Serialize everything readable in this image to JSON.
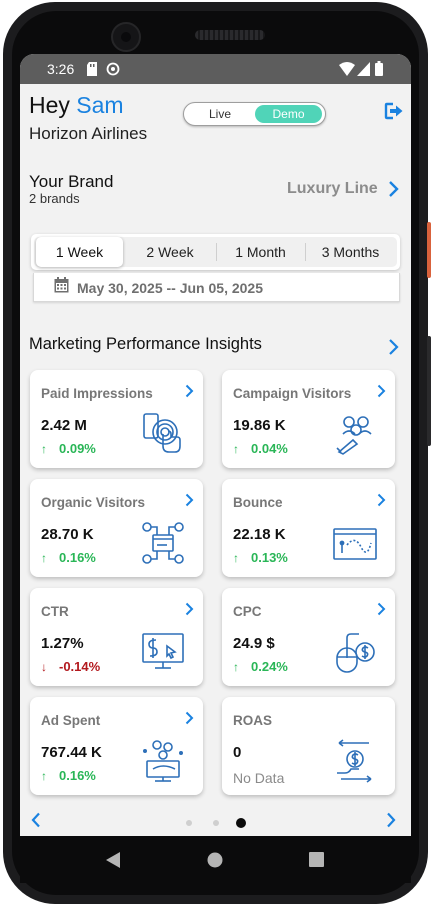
{
  "status_bar": {
    "time": "3:26"
  },
  "header": {
    "greeting": "Hey",
    "user_name": "Sam",
    "company": "Horizon Airlines"
  },
  "mode_toggle": {
    "live_label": "Live",
    "demo_label": "Demo",
    "selected": "Demo"
  },
  "brand": {
    "title": "Your Brand",
    "count_label": "2 brands",
    "selected_brand": "Luxury Line"
  },
  "date_range": {
    "options": [
      "1 Week",
      "2 Week",
      "1 Month",
      "3 Months"
    ],
    "selected": "1 Week",
    "range_text": "May 30, 2025  -- Jun 05, 2025"
  },
  "insights": {
    "title": "Marketing Performance Insights",
    "cards": [
      {
        "title": "Paid Impressions",
        "value": "2.42 M",
        "change": "0.09%",
        "direction": "up",
        "icon": "touch-screen-icon"
      },
      {
        "title": "Campaign Visitors",
        "value": "19.86 K",
        "change": "0.04%",
        "direction": "up",
        "icon": "megaphone-audience-icon"
      },
      {
        "title": "Organic Visitors",
        "value": "28.70 K",
        "change": "0.16%",
        "direction": "up",
        "icon": "network-users-icon"
      },
      {
        "title": "Bounce",
        "value": "22.18 K",
        "change": "0.13%",
        "direction": "up",
        "icon": "bounce-browser-icon"
      },
      {
        "title": "CTR",
        "value": "1.27%",
        "change": "-0.14%",
        "direction": "down",
        "icon": "monitor-click-icon"
      },
      {
        "title": "CPC",
        "value": "24.9 $",
        "change": "0.24%",
        "direction": "up",
        "icon": "mouse-dollar-icon"
      },
      {
        "title": "Ad Spent",
        "value": "767.44 K",
        "change": "0.16%",
        "direction": "up",
        "icon": "money-spend-icon"
      },
      {
        "title": "ROAS",
        "value": "0",
        "change": "No Data",
        "direction": "none",
        "icon": "return-investment-icon"
      }
    ]
  },
  "pagination": {
    "pages": 3,
    "current_page": 3
  },
  "colors": {
    "accent": "#1a82e0",
    "demo_toggle": "#50d4b8",
    "positive": "#2ab657",
    "negative": "#b3191e"
  }
}
